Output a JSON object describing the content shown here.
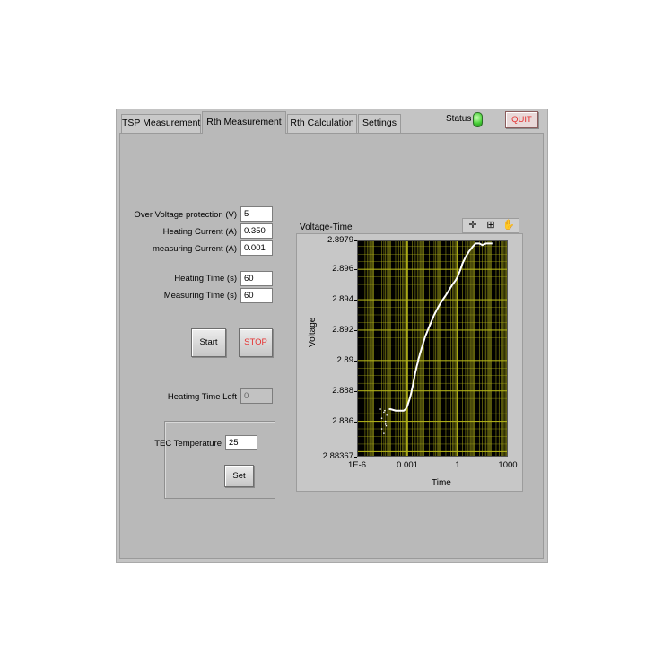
{
  "tabs": [
    {
      "label": "TSP Measurement"
    },
    {
      "label": "Rth Measurement"
    },
    {
      "label": "Rth Calculation"
    },
    {
      "label": "Settings"
    }
  ],
  "status": {
    "label": "Status",
    "led_color": "#4bd13a",
    "state": "on"
  },
  "quit_label": "QUIT",
  "params": {
    "over_voltage": {
      "label": "Over Voltage protection (V)",
      "value": "5"
    },
    "heating_current": {
      "label": "Heating Current (A)",
      "value": "0.350"
    },
    "measuring_current": {
      "label": "measuring Current (A)",
      "value": "0.001"
    },
    "heating_time": {
      "label": "Heating Time (s)",
      "value": "60"
    },
    "measuring_time": {
      "label": "Measuring Time (s)",
      "value": "60"
    }
  },
  "buttons": {
    "start": "Start",
    "stop": "STOP",
    "set": "Set"
  },
  "time_left": {
    "label": "Heatimg Time Left",
    "value": "0"
  },
  "tec": {
    "label": "TEC Temperature",
    "value": "25"
  },
  "graph": {
    "title": "Voltage-Time",
    "tools": [
      "cursor-move-icon",
      "zoom-icon",
      "pan-hand-icon"
    ]
  },
  "chart_data": {
    "type": "line",
    "title": "Voltage-Time",
    "xlabel": "Time",
    "ylabel": "Voltage",
    "x_scale": "log",
    "xlim": [
      1e-06,
      1000
    ],
    "ylim": [
      2.88367,
      2.8979
    ],
    "x_ticks": [
      "1E-6",
      "0.001",
      "1",
      "1000"
    ],
    "y_ticks": [
      "2.8979",
      "2.896",
      "2.894",
      "2.892",
      "2.89",
      "2.888",
      "2.886",
      "2.88367"
    ],
    "background": "#000000",
    "grid_color": "#b3b31a",
    "series_color": "#ffffff",
    "series": [
      {
        "x": [
          8e-05,
          0.0001,
          0.0002,
          0.0004,
          0.0006,
          0.0008,
          0.001,
          0.0015,
          0.002,
          0.003,
          0.005,
          0.008,
          0.012,
          0.02,
          0.04,
          0.07,
          0.1,
          0.2,
          0.3,
          0.5,
          0.8,
          1,
          1.5,
          2,
          3,
          5,
          8,
          12,
          20,
          30,
          50,
          80,
          120
        ],
        "y": [
          2.8868,
          2.8868,
          2.8867,
          2.8867,
          2.8867,
          2.8868,
          2.887,
          2.8876,
          2.8882,
          2.8892,
          2.8902,
          2.891,
          2.8916,
          2.8922,
          2.893,
          2.8935,
          2.8938,
          2.8943,
          2.8946,
          2.895,
          2.8953,
          2.8955,
          2.896,
          2.8964,
          2.8968,
          2.8972,
          2.8975,
          2.8977,
          2.8977,
          2.8976,
          2.8977,
          2.8977,
          2.8977
        ]
      }
    ],
    "scatter_noise": {
      "x": [
        2.5e-05,
        3e-05,
        4e-05,
        5e-05,
        6e-05,
        3e-05,
        4e-05,
        4.5e-05,
        5e-05,
        5.5e-05
      ],
      "y": [
        2.8868,
        2.8862,
        2.8866,
        2.8858,
        2.8864,
        2.8855,
        2.8852,
        2.8867,
        2.886,
        2.8857
      ]
    }
  }
}
